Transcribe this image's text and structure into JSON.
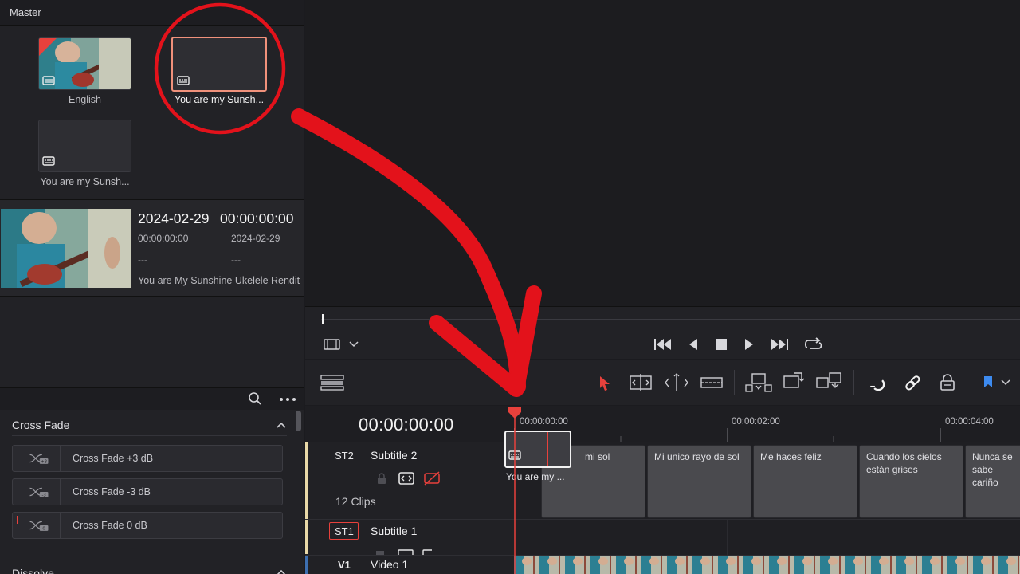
{
  "bin": {
    "title": "Master",
    "clips": [
      {
        "caption": "English"
      },
      {
        "caption": "You are my Sunsh..."
      },
      {
        "caption": "You are my Sunsh..."
      }
    ]
  },
  "info": {
    "date": "2024-02-29",
    "timecode": "00:00:00:00",
    "start_tc": "00:00:00:00",
    "end_date": "2024-02-29",
    "dash1": "---",
    "dash2": "---",
    "clip_name": "You are My Sunshine Ukelele Rendit"
  },
  "effects": {
    "group1": "Cross Fade",
    "items": [
      {
        "label": "Cross Fade +3 dB",
        "badge": "+3"
      },
      {
        "label": "Cross Fade -3 dB",
        "badge": "-3"
      },
      {
        "label": "Cross Fade 0 dB",
        "badge": "0"
      }
    ],
    "group2": "Dissolve"
  },
  "timeline": {
    "timecode": "00:00:00:00",
    "ruler": [
      "00:00:00:00",
      "00:00:02:00",
      "00:00:04:00"
    ],
    "tracks": {
      "st2": {
        "id": "ST2",
        "name": "Subtitle 2",
        "clips_count": "12 Clips"
      },
      "st1": {
        "id": "ST1",
        "name": "Subtitle 1"
      },
      "v1": {
        "id": "V1",
        "name": "Video 1"
      }
    },
    "drag_clip_label": "You are my ...",
    "subtitle_clips": [
      "mi sol",
      "Mi unico rayo de sol",
      "Me haces feliz",
      "Cuando los cielos están grises",
      "Nunca se sabe cariño"
    ]
  },
  "colors": {
    "accent": "#e8413c",
    "annotation": "#e3121b"
  }
}
